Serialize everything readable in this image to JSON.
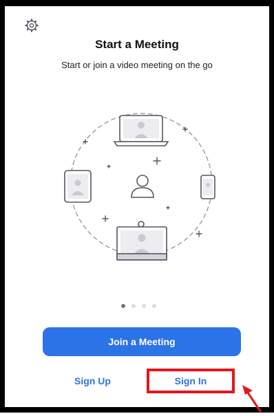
{
  "header": {
    "settings_icon": "gear-icon",
    "title": "Start a Meeting",
    "subtitle": "Start or join a video meeting on the go"
  },
  "carousel": {
    "page_count": 4,
    "active_index": 0
  },
  "actions": {
    "join_label": "Join a Meeting",
    "signup_label": "Sign Up",
    "signin_label": "Sign In"
  },
  "colors": {
    "accent": "#2d73e8",
    "highlight_box": "#e8141c",
    "text_dark": "#111111"
  }
}
